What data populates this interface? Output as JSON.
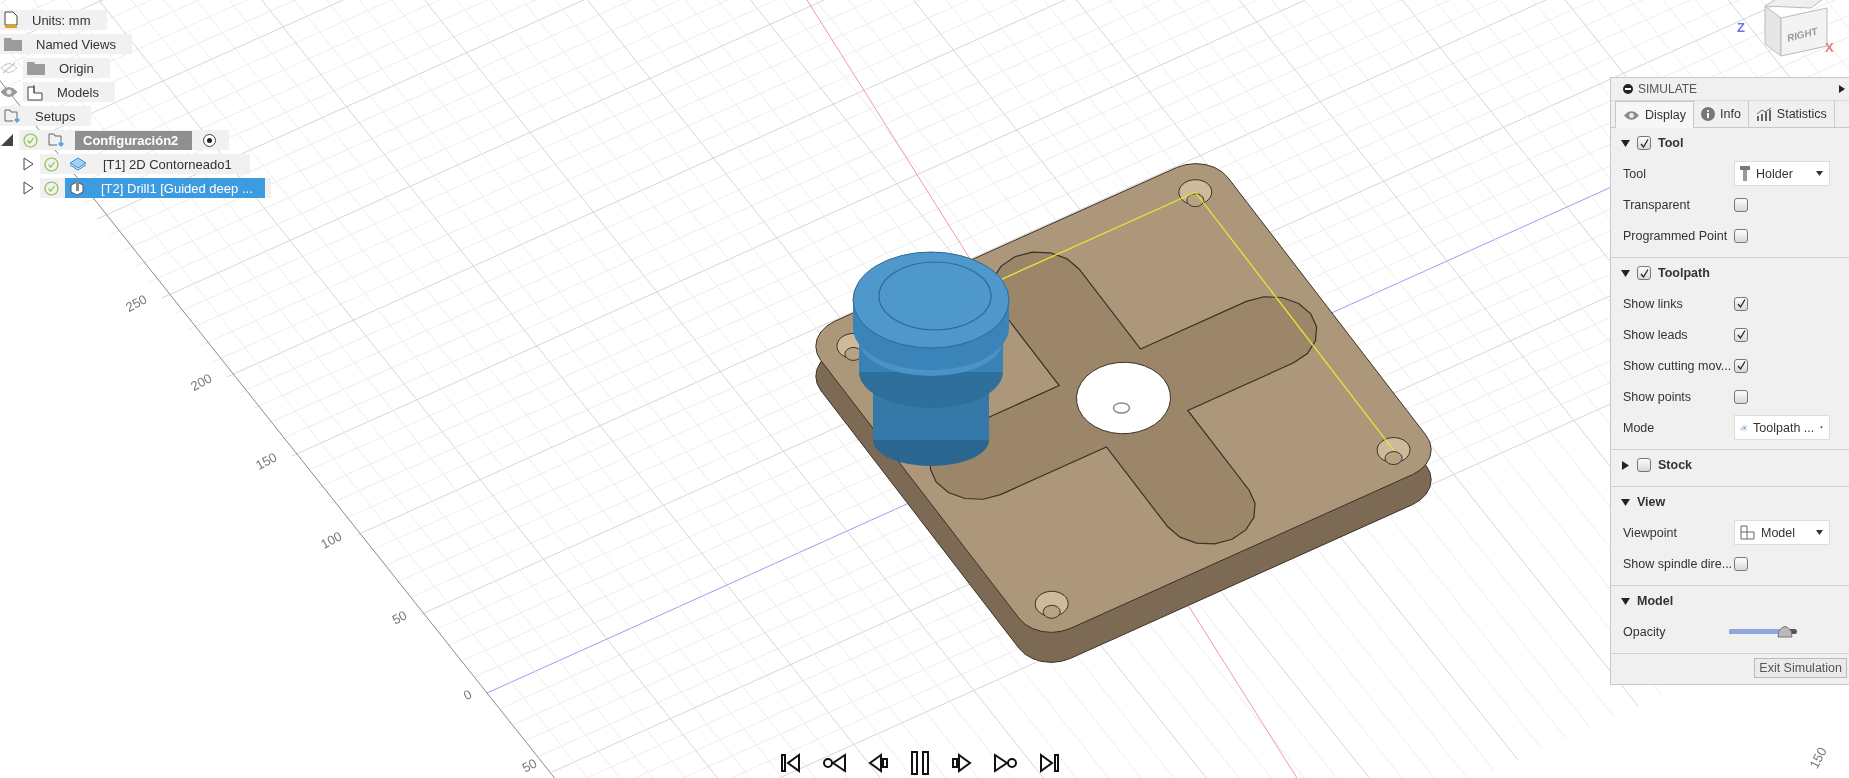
{
  "browser": {
    "items": [
      {
        "kind": "units",
        "label": "Units: mm"
      },
      {
        "kind": "folder",
        "label": "Named Views"
      },
      {
        "kind": "folder",
        "label": "Origin",
        "visible": false
      },
      {
        "kind": "body",
        "label": "Models",
        "visible": true
      },
      {
        "kind": "setups",
        "label": "Setups"
      },
      {
        "kind": "setup",
        "label": "Configuración2",
        "expanded": true,
        "active": true,
        "children": [
          {
            "kind": "contour",
            "label": "[T1] 2D Contorneado1",
            "expanded": false,
            "selected": false
          },
          {
            "kind": "drill",
            "label": "[T2] Drill1 [Guided deep ...",
            "expanded": false,
            "selected": true
          }
        ]
      }
    ]
  },
  "viewport": {
    "axis_labels": [
      "250",
      "200",
      "150",
      "100",
      "50",
      "0",
      "50"
    ],
    "right_axis_labels": [
      "150"
    ]
  },
  "viewcube": {
    "face_label": "RIGHT",
    "axes": [
      {
        "label": "Z",
        "color": "#6f6ff5"
      },
      {
        "label": "X",
        "color": "#f07a7a"
      }
    ]
  },
  "simulate_panel": {
    "title": "SIMULATE",
    "tabs": [
      {
        "label": "Display",
        "selected": true
      },
      {
        "label": "Info",
        "selected": false
      },
      {
        "label": "Statistics",
        "selected": false
      }
    ],
    "sections": [
      {
        "title": "Tool",
        "expanded": true,
        "checked": true,
        "rows": [
          {
            "kind": "dropdown",
            "label": "Tool",
            "value": "Holder"
          },
          {
            "kind": "checkbox",
            "label": "Transparent",
            "checked": false
          },
          {
            "kind": "checkbox",
            "label": "Programmed Point",
            "checked": false
          }
        ]
      },
      {
        "title": "Toolpath",
        "expanded": true,
        "checked": true,
        "rows": [
          {
            "kind": "checkbox",
            "label": "Show links",
            "checked": true
          },
          {
            "kind": "checkbox",
            "label": "Show leads",
            "checked": true
          },
          {
            "kind": "checkbox",
            "label": "Show cutting mov...",
            "checked": true
          },
          {
            "kind": "checkbox",
            "label": "Show points",
            "checked": false
          },
          {
            "kind": "dropdown",
            "label": "Mode",
            "value": "Toolpath ..."
          }
        ]
      },
      {
        "title": "Stock",
        "expanded": false,
        "checked": false
      },
      {
        "title": "View",
        "expanded": true,
        "rows": [
          {
            "kind": "dropdown",
            "label": "Viewpoint",
            "value": "Model"
          },
          {
            "kind": "checkbox",
            "label": "Show spindle dire...",
            "checked": false
          }
        ]
      },
      {
        "title": "Model",
        "expanded": true,
        "rows": [
          {
            "kind": "slider",
            "label": "Opacity",
            "level": 0.82
          }
        ]
      }
    ],
    "button": "Exit Simulation"
  }
}
